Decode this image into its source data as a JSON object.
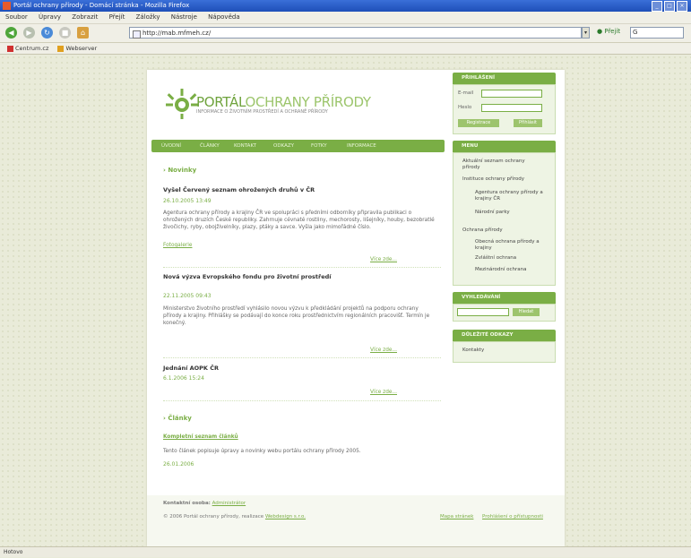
{
  "window": {
    "title": "Portál ochrany přírody - Domácí stránka - Mozilla Firefox"
  },
  "menu": [
    "Soubor",
    "Úpravy",
    "Zobrazit",
    "Přejít",
    "Záložky",
    "Nástroje",
    "Nápověda"
  ],
  "toolbar": {
    "url": "http://mab.mfmeh.cz/",
    "go_label": "Přejít",
    "search_placeholder": "G"
  },
  "bookmarks": [
    "Centrum.cz",
    "Webserver"
  ],
  "site": {
    "logo_part1": "PORTÁL",
    "logo_part2": "OCHRANY PŘÍRODY",
    "tagline": "INFORMACE O ŽIVOTNÍM PROSTŘEDÍ A OCHRANĚ PŘÍRODY",
    "nav": [
      "ÚVODNÍ",
      "ČLÁNKY",
      "KONTAKT",
      "ODKAZY",
      "FOTKY",
      "INFORMACE"
    ]
  },
  "news": {
    "heading": "Novinky",
    "items": [
      {
        "title": "Vyšel Červený seznam ohrožených druhů v ČR",
        "date": "26.10.2005 13:49",
        "text": "Agentura ochrany přírody a krajiny ČR ve spolupráci s předními odborníky připravila publikaci o ohrožených druzích České republiky. Zahrnuje cévnaté rostliny, mechorosty, lišejníky, houby, bezobratlé živočichy, ryby, obojživelníky, plazy, ptáky a savce. Vyšla jako mimořádné číslo.",
        "link": "Fotogalerie",
        "more": "Více zde..."
      },
      {
        "title": "Nová výzva Evropského fondu pro životní prostředí",
        "date": "22.11.2005 09:43",
        "text": "Ministerstvo životního prostředí vyhlásilo novou výzvu k předkládání projektů na podporu ochrany přírody a krajiny. Přihlášky se podávají do konce roku prostřednictvím regionálních pracovišť. Termín je konečný.",
        "more": "Více zde..."
      },
      {
        "title": "Jednání AOPK ČR",
        "date": "6.1.2006 15:24",
        "more": "Více zde..."
      }
    ]
  },
  "articles": {
    "heading": "Články",
    "items": [
      {
        "title": "Kompletní seznam článků",
        "text": "Tento článek popisuje úpravy a novinky webu portálu ochrany přírody 2005.",
        "date": "26.01.2006"
      }
    ]
  },
  "login": {
    "title": "PŘIHLÁŠENÍ",
    "email_label": "E-mail",
    "pass_label": "Heslo",
    "register_label": "Registrace",
    "login_label": "Přihlásit"
  },
  "menu_box": {
    "title": "MENU",
    "items": [
      "Aktuální seznam ochrany přírody",
      "Instituce ochrany přírody",
      "Agentura ochrany přírody a krajiny ČR",
      "Národní parky",
      "Ochrana přírody",
      "Obecná ochrana přírody a krajiny",
      "Zvláštní ochrana",
      "Mezinárodní ochrana"
    ]
  },
  "search": {
    "title": "VYHLEDÁVÁNÍ",
    "button": "Hledat"
  },
  "contacts": {
    "title": "DŮLEŽITÉ ODKAZY",
    "item": "Kontakty"
  },
  "footer": {
    "contact_label": "Kontaktní osoba:",
    "contact_link": "Administrátor",
    "copyright": "© 2006 Portál ochrany přírody, realizace",
    "copyright_link": "Webdesign s.r.o.",
    "link1": "Mapa stránek",
    "link2": "Prohlášení o přístupnosti"
  },
  "status": {
    "text": "Hotovo"
  },
  "colors": {
    "accent": "#7aae45",
    "window_blue": "#2456c8",
    "page_bg": "#e9ebd9"
  }
}
